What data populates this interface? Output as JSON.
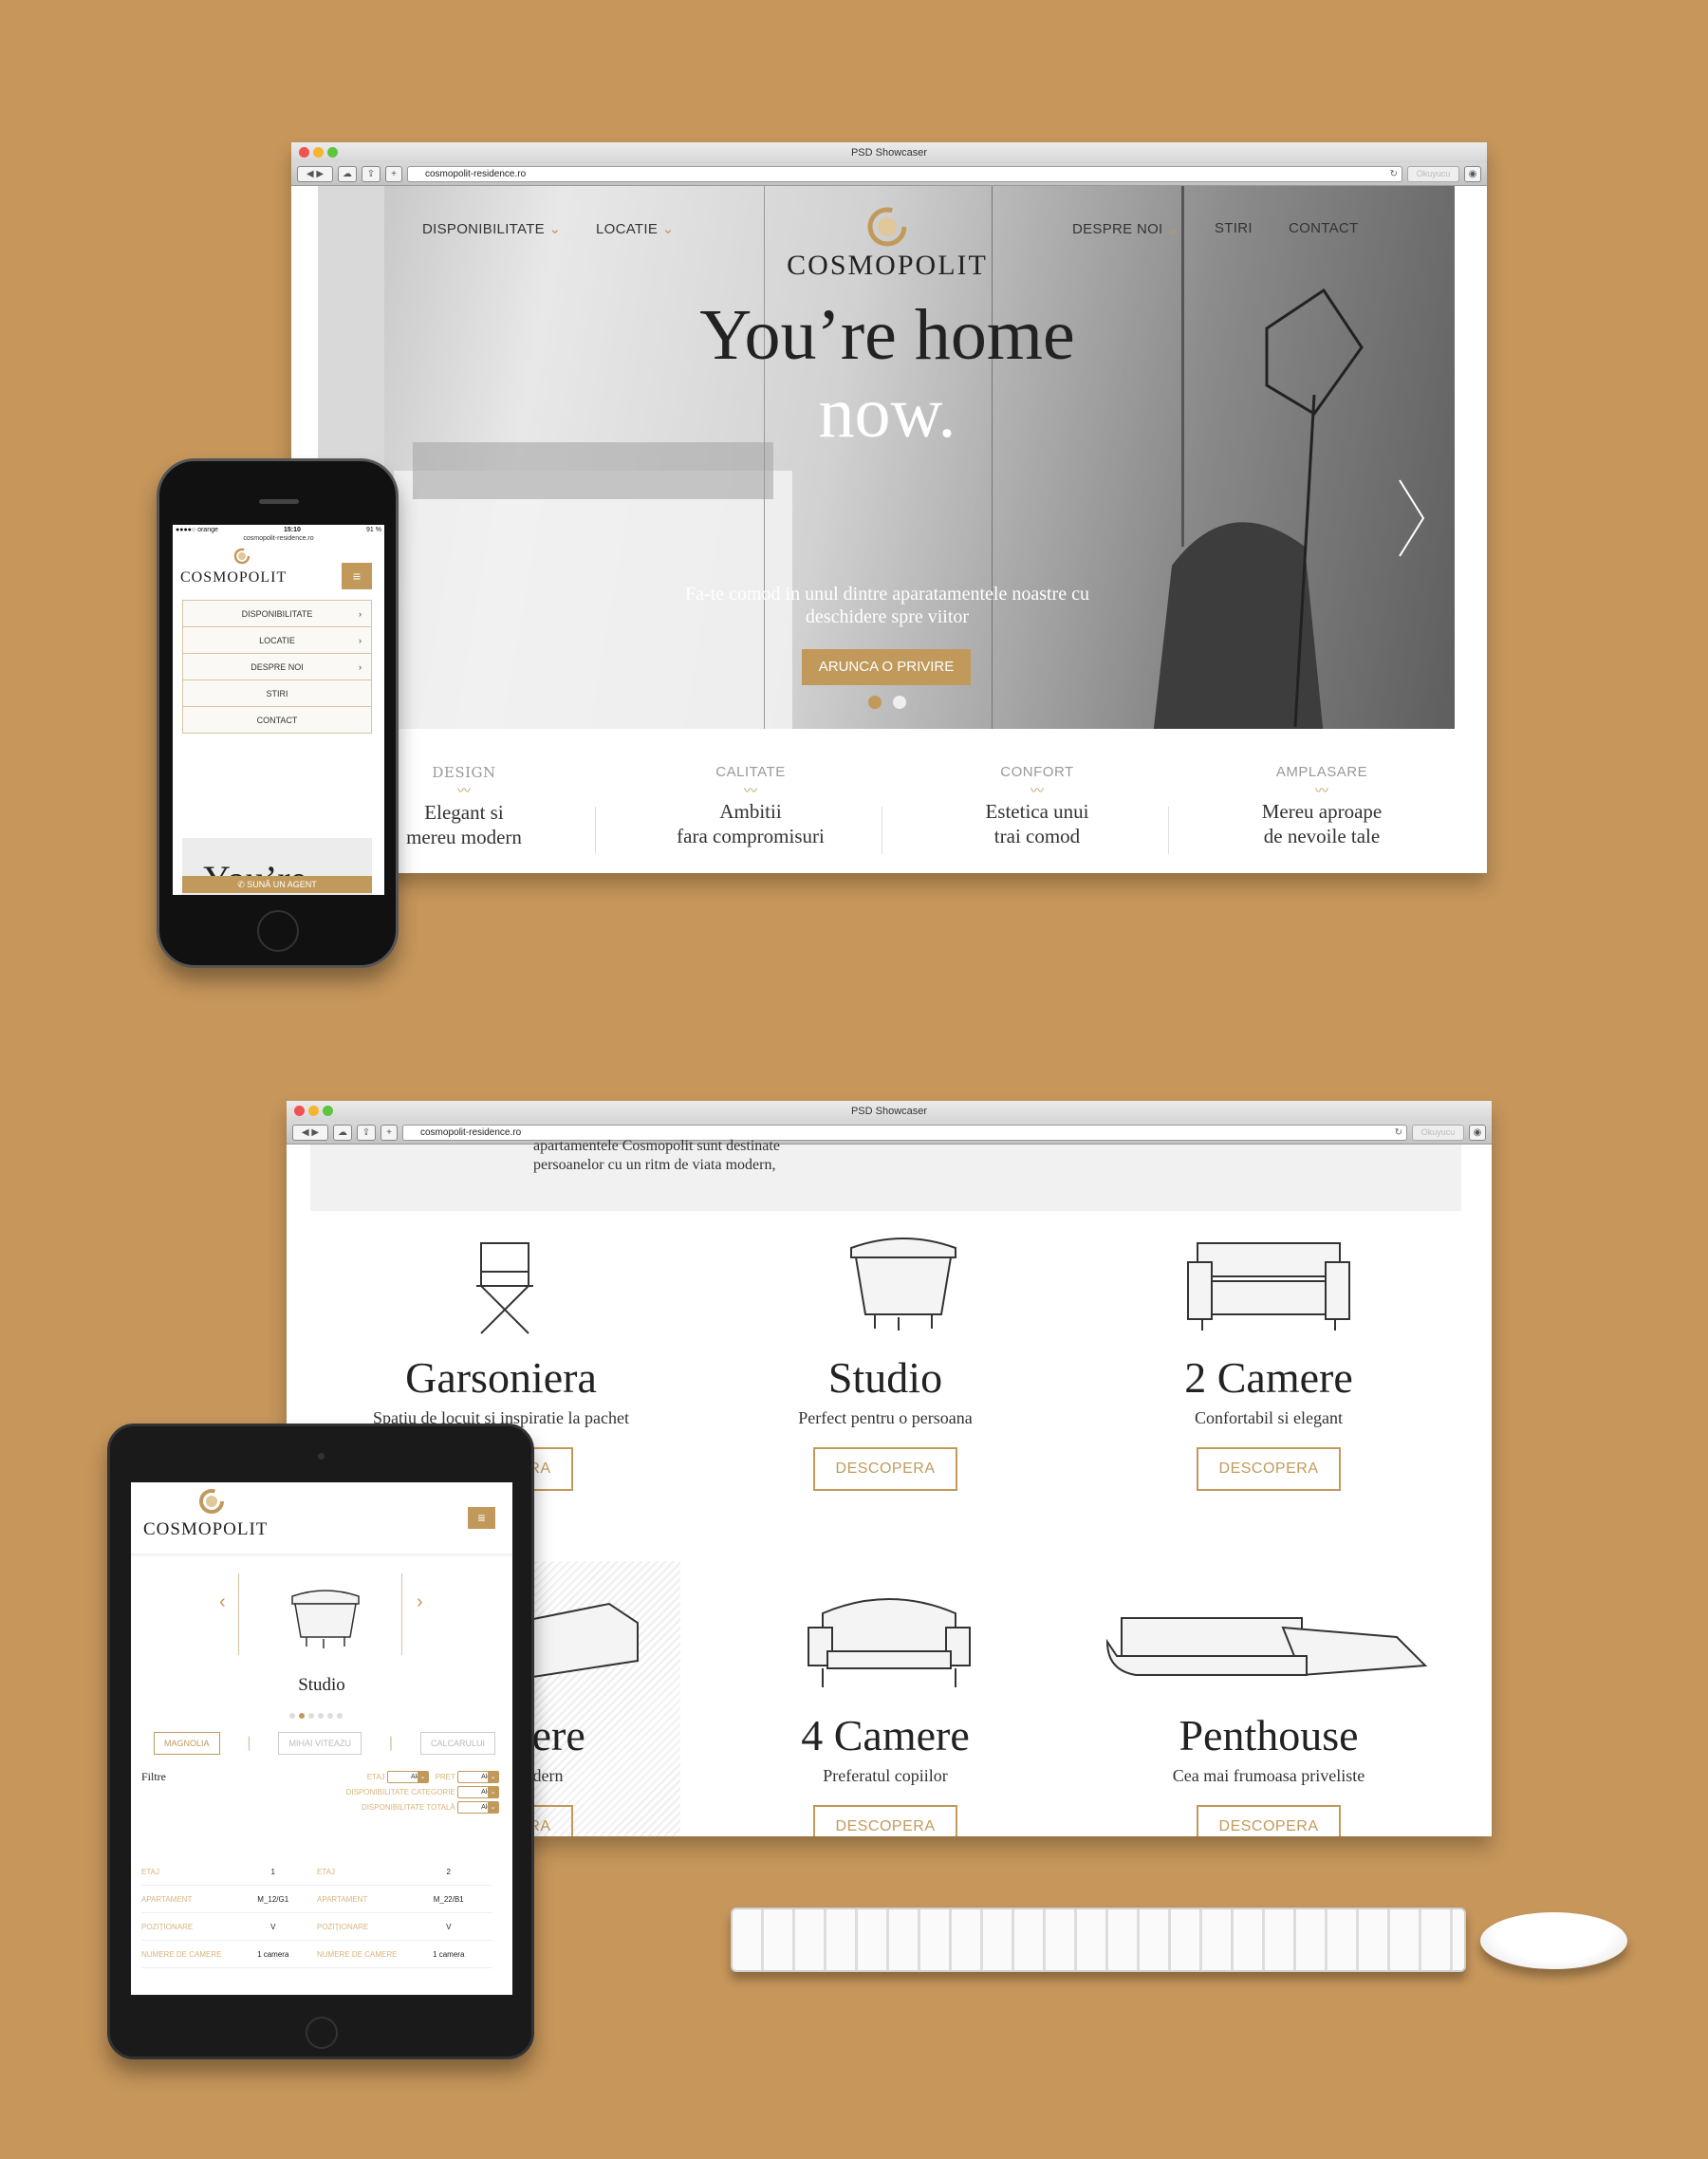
{
  "colors": {
    "background": "#c6965b",
    "accent": "#c19a5b"
  },
  "browser": {
    "title": "PSD Showcaser",
    "url": "cosmopolit-residence.ro",
    "reader": "Okuyucu"
  },
  "site": {
    "logo": "COSMOPOLIT",
    "nav_left": [
      "DISPONIBILITATE",
      "LOCATIE"
    ],
    "nav_right": [
      "DESPRE NOI",
      "STIRI",
      "CONTACT"
    ],
    "hero": {
      "title_line1": "You’re home",
      "title_line2": "now.",
      "subtitle_line1": "Fa-te comod in unul dintre aparatamentele noastre cu",
      "subtitle_line2": "deschidere spre viitor",
      "cta": "ARUNCA O PRIVIRE",
      "slide_active": 1,
      "slide_count": 2
    },
    "features": [
      {
        "key": "DESIGN",
        "l1": "Elegant si",
        "l2": "mereu modern"
      },
      {
        "key": "CALITATE",
        "l1": "Ambitii",
        "l2": "fara compromisuri"
      },
      {
        "key": "CONFORT",
        "l1": "Estetica unui",
        "l2": "trai comod"
      },
      {
        "key": "AMPLASARE",
        "l1": "Mereu aproape",
        "l2": "de nevoile tale"
      }
    ]
  },
  "page2": {
    "intro_line1": "apartamentele Cosmopolit sunt destinate",
    "intro_line2": "persoanelor cu un ritm de viata modern,",
    "cards": [
      {
        "title": "Garsoniera",
        "subtitle": "Spatiu de locuit si inspiratie la pachet",
        "button": "DESCOPERA"
      },
      {
        "title": "Studio",
        "subtitle": "Perfect pentru o persoana",
        "button": "DESCOPERA"
      },
      {
        "title": "2 Camere",
        "subtitle": "Confortabil si elegant",
        "button": "DESCOPERA"
      },
      {
        "title": "3 Camere",
        "subtitle": "Elegant si modern",
        "button": "DESCOPERA"
      },
      {
        "title": "4 Camere",
        "subtitle": "Preferatul copiilor",
        "button": "DESCOPERA"
      },
      {
        "title": "Penthouse",
        "subtitle": "Cea mai frumoasa priveliste",
        "button": "DESCOPERA"
      }
    ]
  },
  "phone": {
    "status": {
      "carrier": "●●●●○ orange",
      "time": "15:10",
      "battery": "91 %"
    },
    "url": "cosmopolit-residence.ro",
    "logo": "COSMOPOLIT",
    "menu": [
      {
        "label": "DISPONIBILITATE",
        "arrow": true
      },
      {
        "label": "LOCATIE",
        "arrow": true
      },
      {
        "label": "DESPRE NOI",
        "arrow": true
      },
      {
        "label": "STIRI",
        "arrow": false
      },
      {
        "label": "CONTACT",
        "arrow": false
      }
    ],
    "hero_peek": "You’re",
    "call": "SUNĂ UN AGENT"
  },
  "tablet": {
    "logo": "COSMOPOLIT",
    "slide_title": "Studio",
    "slide_active": 2,
    "slide_count": 6,
    "locations": [
      "MAGNOLIA",
      "MIHAI VITEAZU",
      "CALCARULUI"
    ],
    "location_active": "MAGNOLIA",
    "filters_title": "Filtre",
    "filters": {
      "etaj": "ETAJ",
      "pret": "PRET",
      "cat": "DISPONIBILITATE CATEGORIE",
      "total": "DISPONIBILITATE TOTALĂ",
      "select": "Alege"
    },
    "table": [
      {
        "label": "ETAJ",
        "a": "1",
        "b": "2"
      },
      {
        "label": "APARTAMENT",
        "a": "M_12/G1",
        "b": "M_22/B1"
      },
      {
        "label": "POZIȚIONARE",
        "a": "V",
        "b": "V"
      },
      {
        "label": "NUMERE DE CAMERE",
        "a": "1 camera",
        "b": "1 camera"
      }
    ]
  }
}
